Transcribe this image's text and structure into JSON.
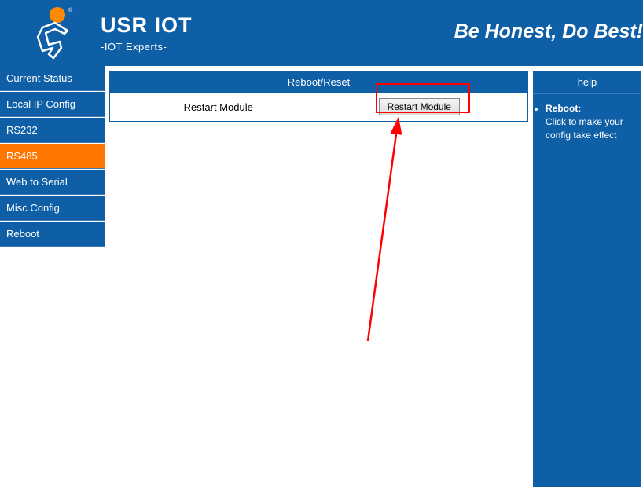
{
  "header": {
    "brand_title": "USR IOT",
    "brand_subtitle": "-IOT Experts-",
    "slogan": "Be Honest, Do Best!"
  },
  "sidebar": {
    "items": [
      {
        "label": "Current Status"
      },
      {
        "label": "Local IP Config"
      },
      {
        "label": "RS232"
      },
      {
        "label": "RS485"
      },
      {
        "label": "Web to Serial"
      },
      {
        "label": "Misc Config"
      },
      {
        "label": "Reboot"
      }
    ]
  },
  "panel": {
    "title": "Reboot/Reset",
    "label": "Restart Module",
    "button_label": "Restart Module"
  },
  "help": {
    "title": "help",
    "item_bold": "Reboot:",
    "item_text": "Click to make your config take effect"
  }
}
